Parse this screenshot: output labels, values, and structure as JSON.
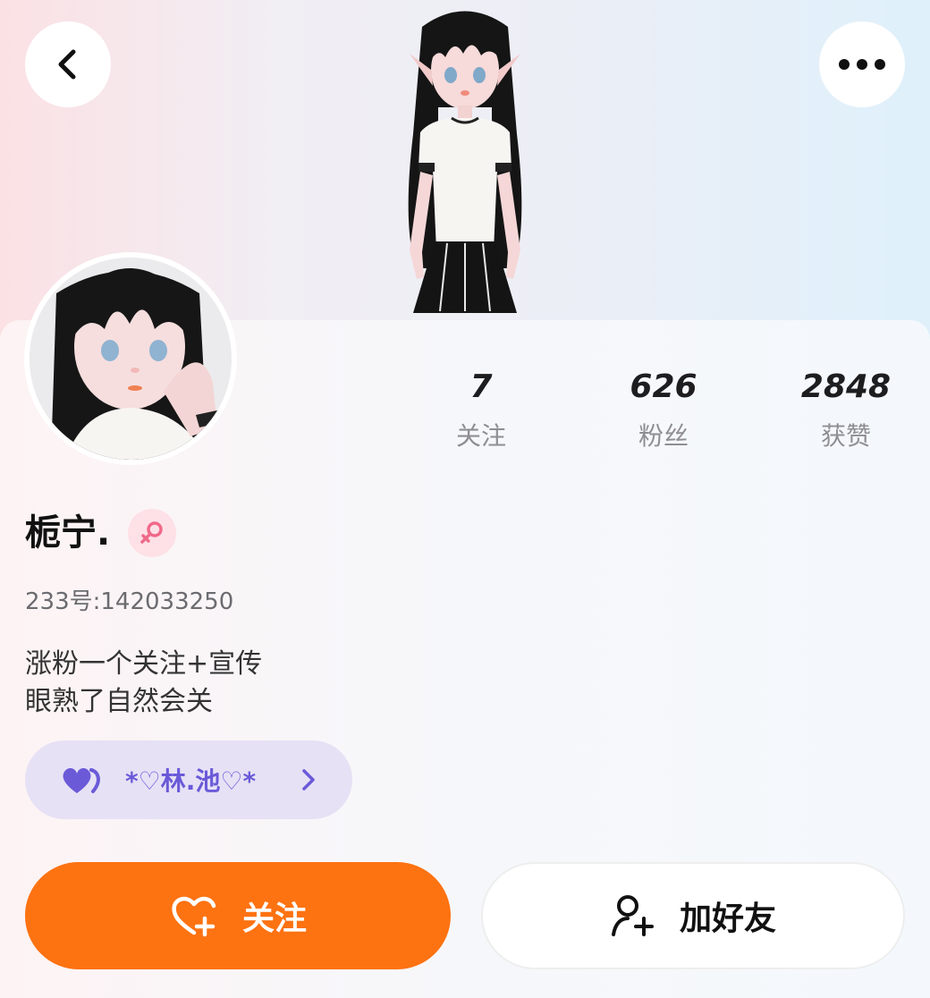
{
  "header": {
    "back_icon": "chevron-left-icon",
    "more_icon": "more-dots-icon"
  },
  "profile": {
    "name": "栀宁.",
    "gender_icon": "female-icon",
    "id_text": "233号:142033250",
    "bio_line1": "涨粉一个关注+宣传",
    "bio_line2": "眼熟了自然会关"
  },
  "stats": [
    {
      "value": "7",
      "label": "关注"
    },
    {
      "value": "626",
      "label": "粉丝"
    },
    {
      "value": "2848",
      "label": "获赞"
    }
  ],
  "group": {
    "icon": "hearts-icon",
    "name": "*♡林.池♡*"
  },
  "actions": {
    "follow_label": "关注",
    "follow_icon": "heart-plus-icon",
    "add_friend_label": "加好友",
    "add_friend_icon": "add-user-icon"
  },
  "colors": {
    "accent": "#fd7211",
    "group_bg": "#e6e1f5",
    "group_text": "#6a5ad8",
    "gender_bg": "#fde1e7",
    "gender_fg": "#f06a8a"
  }
}
